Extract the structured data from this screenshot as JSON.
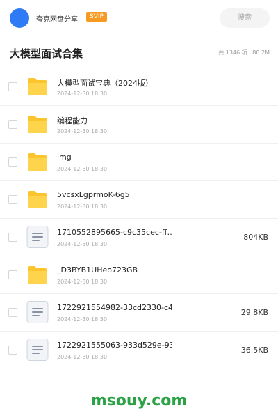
{
  "header": {
    "app_name": "夸克网盘分享",
    "badge": "SVIP",
    "search_placeholder": "搜索"
  },
  "folder": {
    "title": "大模型面试合集",
    "summary": "共 1346 项 · 80.2M"
  },
  "files": [
    {
      "type": "folder",
      "name": "大模型面试宝典（2024版）",
      "date": "2024-12-30 18:30",
      "size": ""
    },
    {
      "type": "folder",
      "name": "编程能力",
      "date": "2024-12-30 18:30",
      "size": ""
    },
    {
      "type": "folder",
      "name": "img",
      "date": "2024-12-30 18:30",
      "size": ""
    },
    {
      "type": "folder",
      "name": "5vcsxLgprmoK-6g5",
      "date": "2024-12-30 18:30",
      "size": ""
    },
    {
      "type": "file",
      "name": "1710552895665-c9c35cec-ff…",
      "date": "2024-12-30 18:30",
      "size": "804KB"
    },
    {
      "type": "folder",
      "name": "_D3BYB1UHeo723GB",
      "date": "2024-12-30 18:30",
      "size": ""
    },
    {
      "type": "file",
      "name": "1722921554982-33cd2330-c4…",
      "date": "2024-12-30 18:30",
      "size": "29.8KB"
    },
    {
      "type": "file",
      "name": "1722921555063-933d529e-93…",
      "date": "2024-12-30 18:30",
      "size": "36.5KB"
    }
  ],
  "watermark": "msouy.com",
  "colors": {
    "accent": "#2f7bf6",
    "badge": "#f59a23",
    "folder": "#fcc52d",
    "watermark": "#2ba245"
  }
}
